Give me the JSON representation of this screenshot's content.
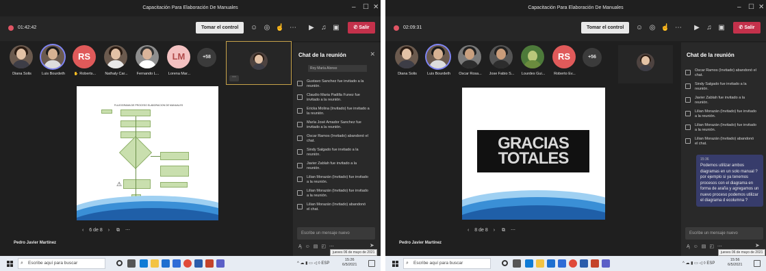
{
  "colors": {
    "accent_purple": "#7f85f5",
    "leave_red": "#c4314b",
    "teams_bg": "#1f1f1f",
    "chat_bubble": "#373c6b",
    "slide_gold_border": "#c8a34a"
  },
  "left": {
    "window_title": "Capacitación Para Elaboración De Manuales",
    "timer": "01:42:42",
    "take_control": "Tomar el control",
    "leave": "Salir",
    "participants": [
      {
        "name": "Diana Solis",
        "initials": "",
        "photo": true
      },
      {
        "name": "Luis Bourdeth",
        "initials": "",
        "photo": true
      },
      {
        "name": "Roberts...",
        "initials": "RS",
        "photo": false,
        "color": "#e05a5a"
      },
      {
        "name": "Nathaly Car...",
        "initials": "",
        "photo": true
      },
      {
        "name": "Fernando L...",
        "initials": "",
        "photo": true
      },
      {
        "name": "Lorena Mar...",
        "initials": "LM",
        "photo": false,
        "color": "#f3c1c1"
      }
    ],
    "more_count": "+58",
    "slide_title": "FLUJOGRAMA DE PROCESO ELABORACION DE MANUALES",
    "pager": "6 de 8",
    "presenter": "Pedro Javier Martínez",
    "chat_title": "Chat de la reunión",
    "chat_partial_name": "Roy María Alonso",
    "chat_messages": [
      "Gustavo Sanchez fue invitado a la reunión.",
      "Claudio Maria Padilla Funez fue invitado a la reunión.",
      "Ericka Molina (Invitado) fue invitado a la reunión.",
      "María José Amador Sanchez fue invitado a la reunión.",
      "Oscar Ramos (Invitado) abandonó el chat.",
      "Sindy Salgado fue invitado a la reunión.",
      "Javier Zablah fue invitado a la reunión.",
      "Lilian Morazán (Invitado) fue invitado a la reunión.",
      "Lilian Morazán (Invitado) fue invitado a la reunión.",
      "Lilian Morazán (Invitado) abandonó el chat."
    ],
    "compose_placeholder": "Escribe un mensaje nuevo",
    "tooltip": "jueves 06 de mayo de 2021",
    "search_placeholder": "Escribe aquí para buscar",
    "sys_lang": "ESP",
    "clock_time": "15:26",
    "clock_date": "6/5/2021"
  },
  "right": {
    "window_title": "Capacitación Para Elaboración De Manuales",
    "timer": "02:09:31",
    "take_control": "Tomar el control",
    "leave": "Salir",
    "participants": [
      {
        "name": "Diana Solis",
        "initials": "",
        "photo": true
      },
      {
        "name": "Luis Bourdeth",
        "initials": "",
        "photo": true
      },
      {
        "name": "Oscar Rosa...",
        "initials": "",
        "photo": true
      },
      {
        "name": "Jose Fabio S...",
        "initials": "",
        "photo": true
      },
      {
        "name": "Lourdes Gui...",
        "initials": "",
        "photo": true
      },
      {
        "name": "Roberto Ev...",
        "initials": "RS",
        "photo": false,
        "color": "#e05a5a"
      }
    ],
    "more_count": "+56",
    "slide_text_1": "GRACIAS",
    "slide_text_2": "TOTALES",
    "pager": "8 de 8",
    "presenter": "Pedro Javier Martínez",
    "chat_title": "Chat de la reunión",
    "chat_messages": [
      "Oscar Ramos (Invitado) abandonó el chat.",
      "Sindy Salgado fue invitado a la reunión.",
      "Javier Zablah fue invitado a la reunión.",
      "Lilian Morazán (Invitado) fue invitado a la reunión.",
      "Lilian Morazán (Invitado) fue invitado a la reunión.",
      "Lilian Morazán (Invitado) abandonó el chat."
    ],
    "bubble_time": "15:36",
    "bubble_text": "Podemos utilizar ambos diagramas en un solo manual ? por ejemplo si ya tenemos procesos con el diagrama en forma de araña y agregamos un nuevo proceso podemos utilizar el diagrama d ecolumna ?",
    "compose_placeholder": "Escribe un mensaje nuevo",
    "tooltip": "jueves 06 de mayo de 2021",
    "search_placeholder": "Escribe aquí para buscar",
    "sys_lang": "ESP",
    "clock_time": "15:56",
    "clock_date": "6/5/2021"
  }
}
